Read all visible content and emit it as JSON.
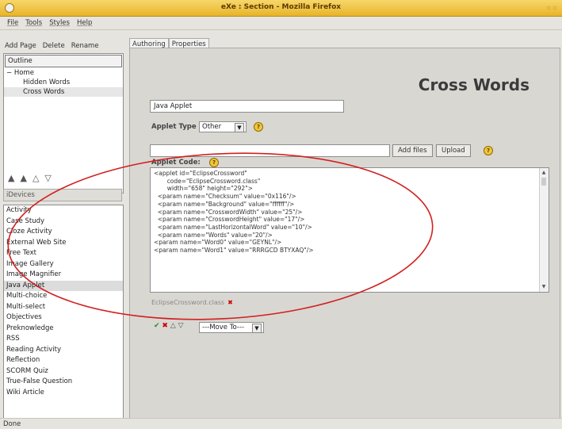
{
  "window": {
    "title": "eXe : Section - Mozilla Firefox"
  },
  "menu": [
    "File",
    "Tools",
    "Styles",
    "Help"
  ],
  "left": {
    "page_buttons": [
      "Add Page",
      "Delete",
      "Rename"
    ],
    "outline": {
      "header": "Outline",
      "items": [
        {
          "label": "Home",
          "prefix": "−"
        },
        {
          "label": "Hidden Words"
        },
        {
          "label": "Cross Words"
        }
      ]
    },
    "tree_icons": [
      "▲",
      "▲",
      "△",
      "▽"
    ],
    "idevices_header": "iDevices",
    "idevices": [
      "Activity",
      "Case Study",
      "Cloze Activity",
      "External Web Site",
      "Free Text",
      "Image Gallery",
      "Image Magnifier",
      "Java Applet",
      "Multi-choice",
      "Multi-select",
      "Objectives",
      "Preknowledge",
      "RSS",
      "Reading Activity",
      "Reflection",
      "SCORM Quiz",
      "True-False Question",
      "Wiki Article"
    ]
  },
  "tabs": [
    "Authoring",
    "Properties"
  ],
  "main": {
    "heading": "Cross Words",
    "title_value": "Java Applet",
    "applet_type_label": "Applet Type",
    "applet_type_value": "Other",
    "add_files": "Add files",
    "upload": "Upload",
    "applet_code_label": "Applet Code:",
    "code_lines": [
      "<applet id=\"EclipseCrossword\"",
      "       code=\"EclipseCrossword.class\"",
      "       width=\"658\" height=\"292\">",
      "",
      "  <param name=\"Checksum\" value=\"0x116\"/>",
      "  <param name=\"Background\" value=\"ffffff\"/>",
      "  <param name=\"CrosswordWidth\" value=\"25\"/>",
      "  <param name=\"CrosswordHeight\" value=\"17\"/>",
      "  <param name=\"LastHorizontalWord\" value=\"10\"/>",
      "  <param name=\"Words\" value=\"20\"/>",
      "",
      "<param name=\"Word0\" value=\"GEYNL\"/>",
      "<param name=\"Word1\" value=\"RRRGCD BTYXAQ\"/>"
    ],
    "class_file": "EclipseCrossword.class",
    "move_to": "---Move To---"
  },
  "status": "Done",
  "colors": {
    "titlebar": "#e8b42a",
    "annotation": "#d22020"
  }
}
